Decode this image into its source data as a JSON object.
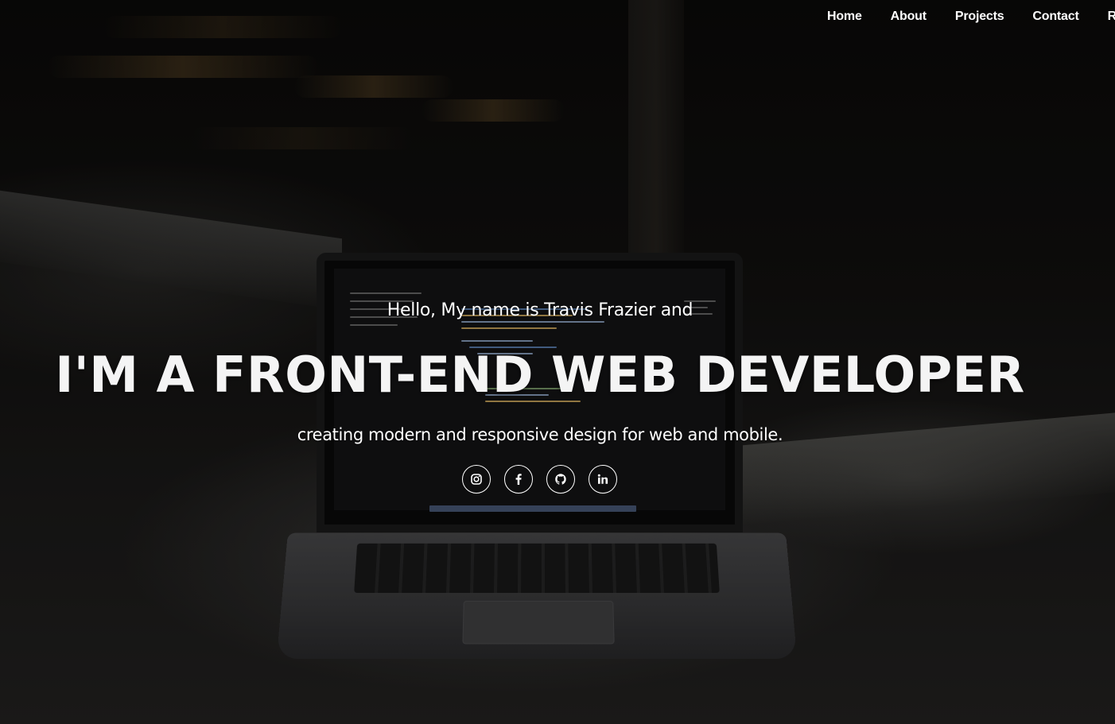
{
  "nav": {
    "items": [
      {
        "label": "Home"
      },
      {
        "label": "About"
      },
      {
        "label": "Projects"
      },
      {
        "label": "Contact"
      },
      {
        "label": "Re"
      }
    ]
  },
  "hero": {
    "greeting": "Hello, My name is Travis Frazier and",
    "headline": "I'M A FRONT-END WEB DEVELOPER",
    "tagline": "creating modern and responsive design for web and mobile.",
    "socials": [
      {
        "icon": "instagram-icon"
      },
      {
        "icon": "facebook-icon"
      },
      {
        "icon": "github-icon"
      },
      {
        "icon": "linkedin-icon"
      }
    ]
  },
  "colors": {
    "text": "#ffffff",
    "background": "#0d0c0b"
  }
}
